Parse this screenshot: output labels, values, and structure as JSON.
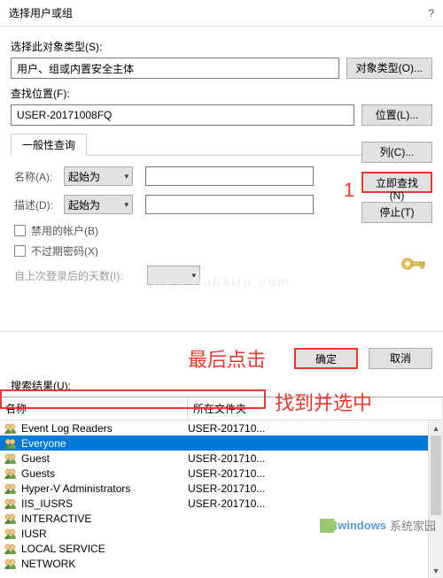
{
  "title": "选择用户或组",
  "object_type_label": "选择此对象类型(S):",
  "object_type_value": "用户、组或内置安全主体",
  "object_type_btn": "对象类型(O)...",
  "location_label": "查找位置(F):",
  "location_value": "USER-20171008FQ",
  "location_btn": "位置(L)...",
  "tab_general": "一般性查询",
  "name_label": "名称(A):",
  "desc_label": "描述(D):",
  "combo_starts": "起始为",
  "chk_disabled": "禁用的帐户(B)",
  "chk_pwd": "不过期密码(X)",
  "last_login_label": "自上次登录后的天数(I):",
  "btn_columns": "列(C)...",
  "btn_findnow": "立即查找(N)",
  "btn_stop": "停止(T)",
  "results_label": "搜索结果(U):",
  "btn_ok": "确定",
  "btn_cancel": "取消",
  "anno_step1": "1",
  "anno_last": "最后点击",
  "anno_found": "找到并选中",
  "col_name": "名称",
  "col_folder": "所在文件夹",
  "rows": [
    {
      "name": "Event Log Readers",
      "folder": "USER-201710..."
    },
    {
      "name": "Everyone",
      "folder": "",
      "selected": true
    },
    {
      "name": "Guest",
      "folder": "USER-201710..."
    },
    {
      "name": "Guests",
      "folder": "USER-201710..."
    },
    {
      "name": "Hyper-V Administrators",
      "folder": "USER-201710..."
    },
    {
      "name": "IIS_IUSRS",
      "folder": "USER-201710..."
    },
    {
      "name": "INTERACTIVE",
      "folder": ""
    },
    {
      "name": "IUSR",
      "folder": ""
    },
    {
      "name": "LOCAL SERVICE",
      "folder": ""
    },
    {
      "name": "NETWORK",
      "folder": ""
    }
  ],
  "watermark1": "windows",
  "watermark2": "系统家园",
  "faint_wm": "www.jiuhaitu.com"
}
